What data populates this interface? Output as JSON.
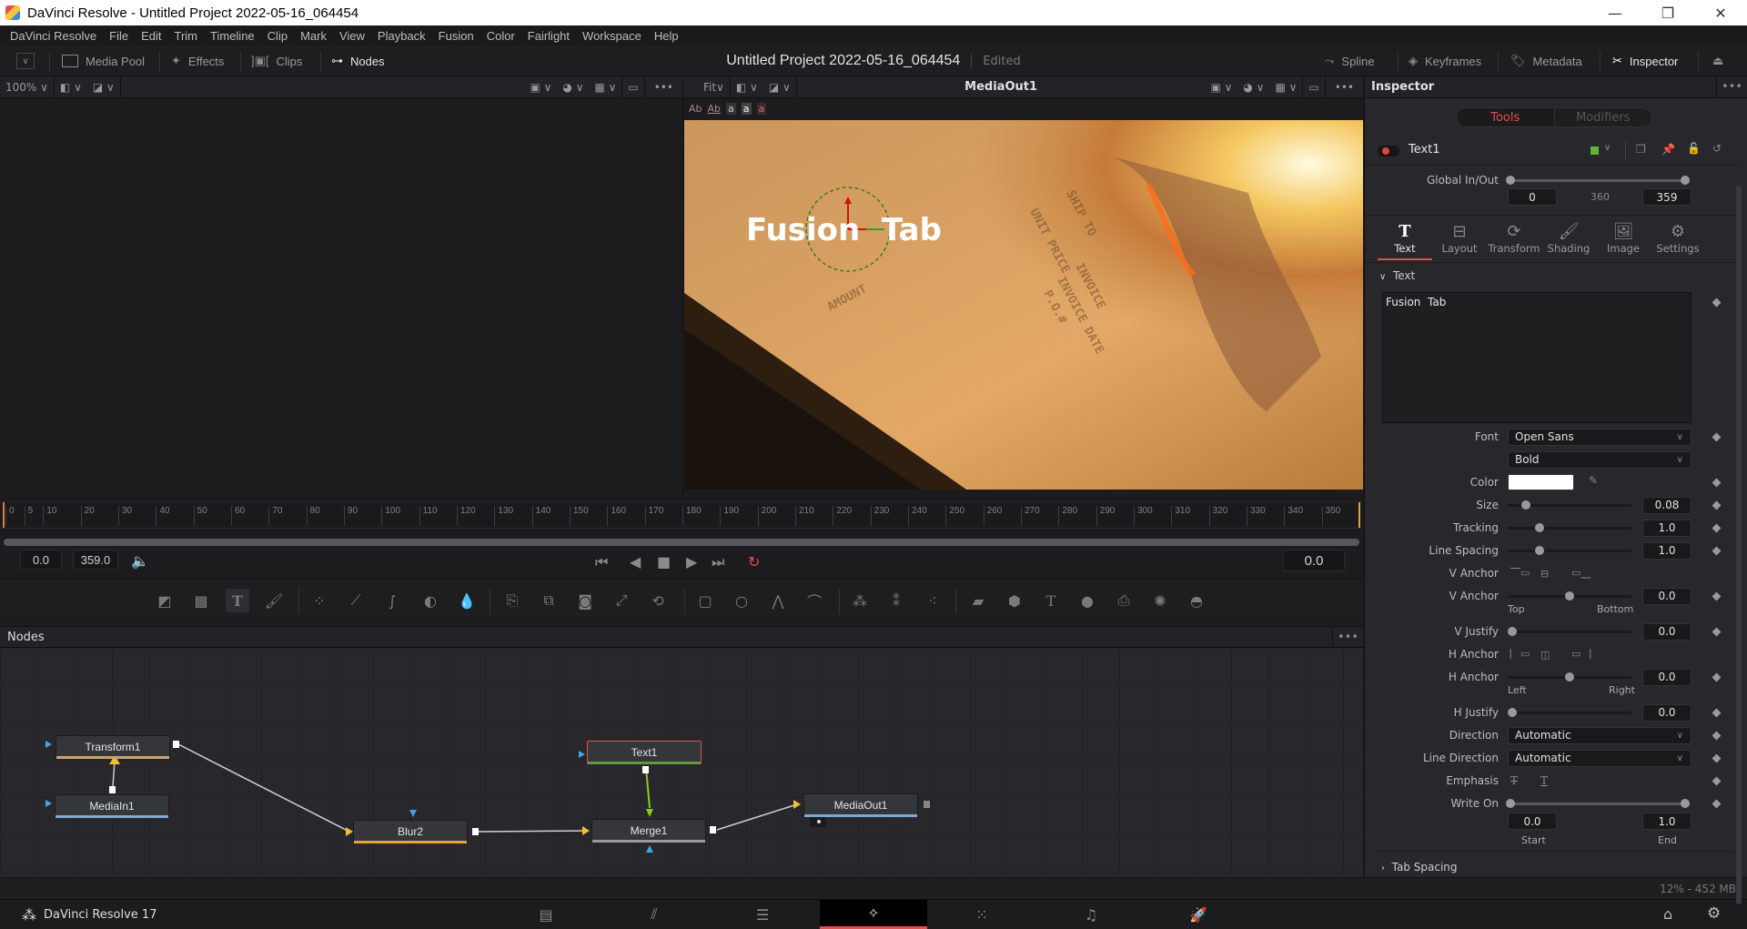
{
  "window": {
    "title": "DaVinci Resolve - Untitled Project 2022-05-16_064454",
    "minimize": "—",
    "restore": "❐",
    "close": "✕"
  },
  "menu": [
    "DaVinci Resolve",
    "File",
    "Edit",
    "Trim",
    "Timeline",
    "Clip",
    "Mark",
    "View",
    "Playback",
    "Fusion",
    "Color",
    "Fairlight",
    "Workspace",
    "Help"
  ],
  "toolbar": {
    "media_pool": "Media Pool",
    "effects": "Effects",
    "clips": "Clips",
    "nodes": "Nodes",
    "project_title": "Untitled Project 2022-05-16_064454",
    "status": "Edited",
    "spline": "Spline",
    "keyframes": "Keyframes",
    "metadata": "Metadata",
    "inspector": "Inspector"
  },
  "left_viewer": {
    "zoom": "100%"
  },
  "right_viewer": {
    "zoom": "Fit",
    "title": "MediaOut1",
    "text_tools": [
      "Ab",
      "Ab",
      "a",
      "a",
      "a"
    ],
    "overlay_text": "Fusion  Tab"
  },
  "timeline": {
    "ticks": [
      "0",
      "5",
      "10",
      "20",
      "30",
      "40",
      "50",
      "60",
      "70",
      "80",
      "90",
      "100",
      "110",
      "120",
      "130",
      "140",
      "150",
      "160",
      "170",
      "180",
      "190",
      "200",
      "210",
      "220",
      "230",
      "240",
      "250",
      "260",
      "270",
      "280",
      "290",
      "300",
      "310",
      "320",
      "330",
      "340",
      "350"
    ],
    "start": "0.0",
    "end": "359.0",
    "current": "0.0"
  },
  "nodes_panel": {
    "title": "Nodes",
    "nodes": [
      {
        "name": "Transform1",
        "color": "#c9a27a"
      },
      {
        "name": "MediaIn1",
        "color": "#7fa8d6"
      },
      {
        "name": "Blur2",
        "color": "#e8a23a"
      },
      {
        "name": "Text1",
        "color": "#5f9a3c"
      },
      {
        "name": "Merge1",
        "color": "#9a9a9a"
      },
      {
        "name": "MediaOut1",
        "color": "#7fa8d6"
      }
    ]
  },
  "status": {
    "memory": "12% - 452 MB"
  },
  "bottom_nav": {
    "app_name": "DaVinci Resolve 17",
    "pages": [
      "media",
      "cut",
      "edit",
      "fusion",
      "color",
      "fairlight",
      "deliver"
    ],
    "active_page": "fusion"
  },
  "inspector": {
    "title": "Inspector",
    "tabs_toggle": {
      "tools": "Tools",
      "modifiers": "Modifiers"
    },
    "tool_name": "Text1",
    "tool_color": "#5fb33a",
    "global_in_out": {
      "label": "Global In/Out",
      "in": "0",
      "duration": "360",
      "out": "359"
    },
    "sub_tabs": [
      "Text",
      "Layout",
      "Transform",
      "Shading",
      "Image",
      "Settings"
    ],
    "active_sub_tab": "Text",
    "section_text": "Text",
    "styled_text": "Fusion  Tab",
    "font_label": "Font",
    "font": "Open Sans",
    "font_style": "Bold",
    "color_label": "Color",
    "text_color": "#ffffff",
    "size": {
      "label": "Size",
      "value": "0.08",
      "fraction": 0.12
    },
    "tracking": {
      "label": "Tracking",
      "value": "1.0",
      "fraction": 0.24
    },
    "line_spacing": {
      "label": "Line Spacing",
      "value": "1.0",
      "fraction": 0.24
    },
    "v_anchor_buttons_label": "V Anchor",
    "v_anchor": {
      "label": "V Anchor",
      "value": "0.0",
      "fraction": 0.5,
      "min_label": "Top",
      "max_label": "Bottom"
    },
    "v_justify": {
      "label": "V Justify",
      "value": "0.0",
      "fraction": 0.0
    },
    "h_anchor_buttons_label": "H Anchor",
    "h_anchor": {
      "label": "H Anchor",
      "value": "0.0",
      "fraction": 0.5,
      "min_label": "Left",
      "max_label": "Right"
    },
    "h_justify": {
      "label": "H Justify",
      "value": "0.0",
      "fraction": 0.0
    },
    "direction": {
      "label": "Direction",
      "value": "Automatic"
    },
    "line_direction": {
      "label": "Line Direction",
      "value": "Automatic"
    },
    "emphasis_label": "Emphasis",
    "write_on": {
      "label": "Write On",
      "start": "0.0",
      "end": "1.0",
      "start_label": "Start",
      "end_label": "End"
    },
    "tab_spacing": "Tab Spacing"
  }
}
